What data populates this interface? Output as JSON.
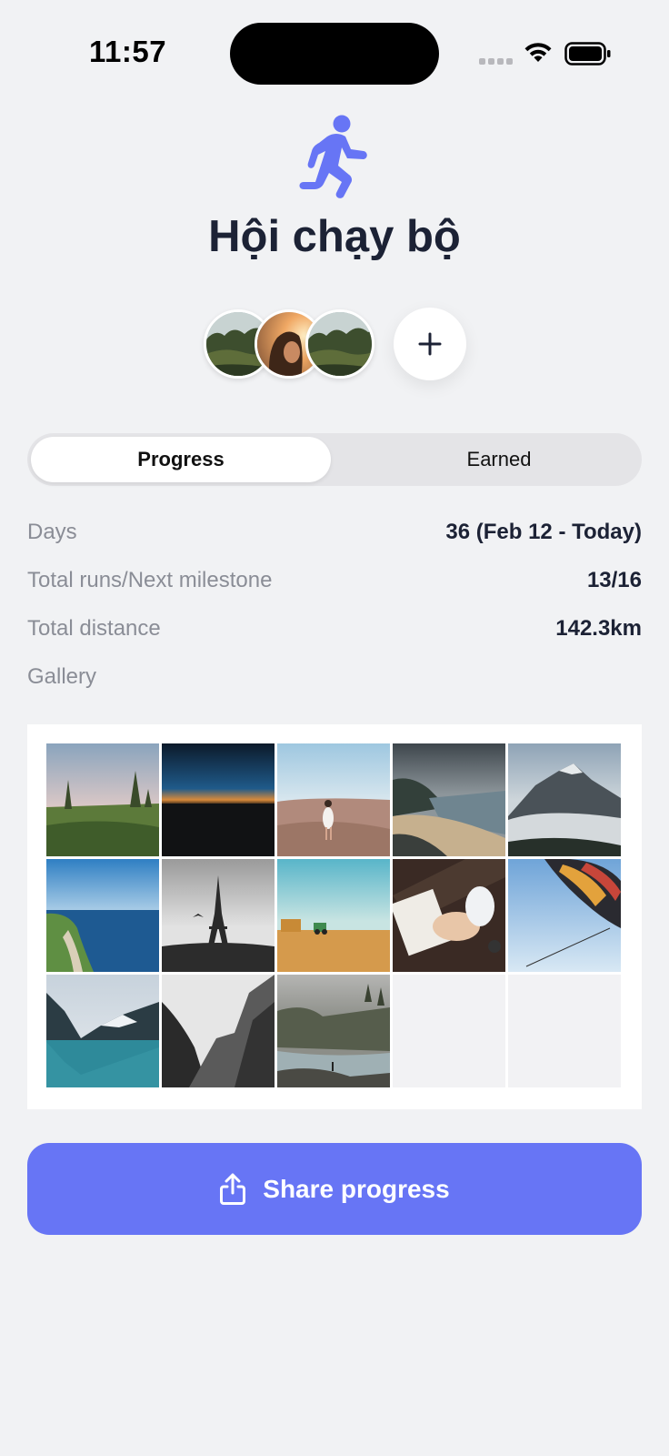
{
  "status_bar": {
    "time": "11:57"
  },
  "group": {
    "title": "Hội chạy bộ",
    "icon": "running-person-icon",
    "accent_color": "#6775f5",
    "members": [
      {
        "avatar": "forest-landscape"
      },
      {
        "avatar": "woman-sunset"
      },
      {
        "avatar": "forest-landscape"
      }
    ],
    "add_member_label": "+"
  },
  "tabs": [
    {
      "label": "Progress",
      "selected": true
    },
    {
      "label": "Earned",
      "selected": false
    }
  ],
  "stats": [
    {
      "label": "Days",
      "value": "36 (Feb 12 - Today)"
    },
    {
      "label": "Total runs/Next milestone",
      "value": "13/16"
    },
    {
      "label": "Total distance",
      "value": "142.3km"
    }
  ],
  "gallery": {
    "label": "Gallery",
    "photos": [
      "meadow-trees",
      "night-horizon",
      "woman-desert",
      "coast-beach",
      "misty-mountain",
      "sea-cliffs",
      "eiffel-tower-bw",
      "field-tractor",
      "hands-writing",
      "hot-air-balloon",
      "mountain-lake",
      "bw-mountains",
      "river-valley"
    ],
    "empty_slots": 2
  },
  "share_button": {
    "label": "Share progress",
    "icon": "share-icon"
  }
}
